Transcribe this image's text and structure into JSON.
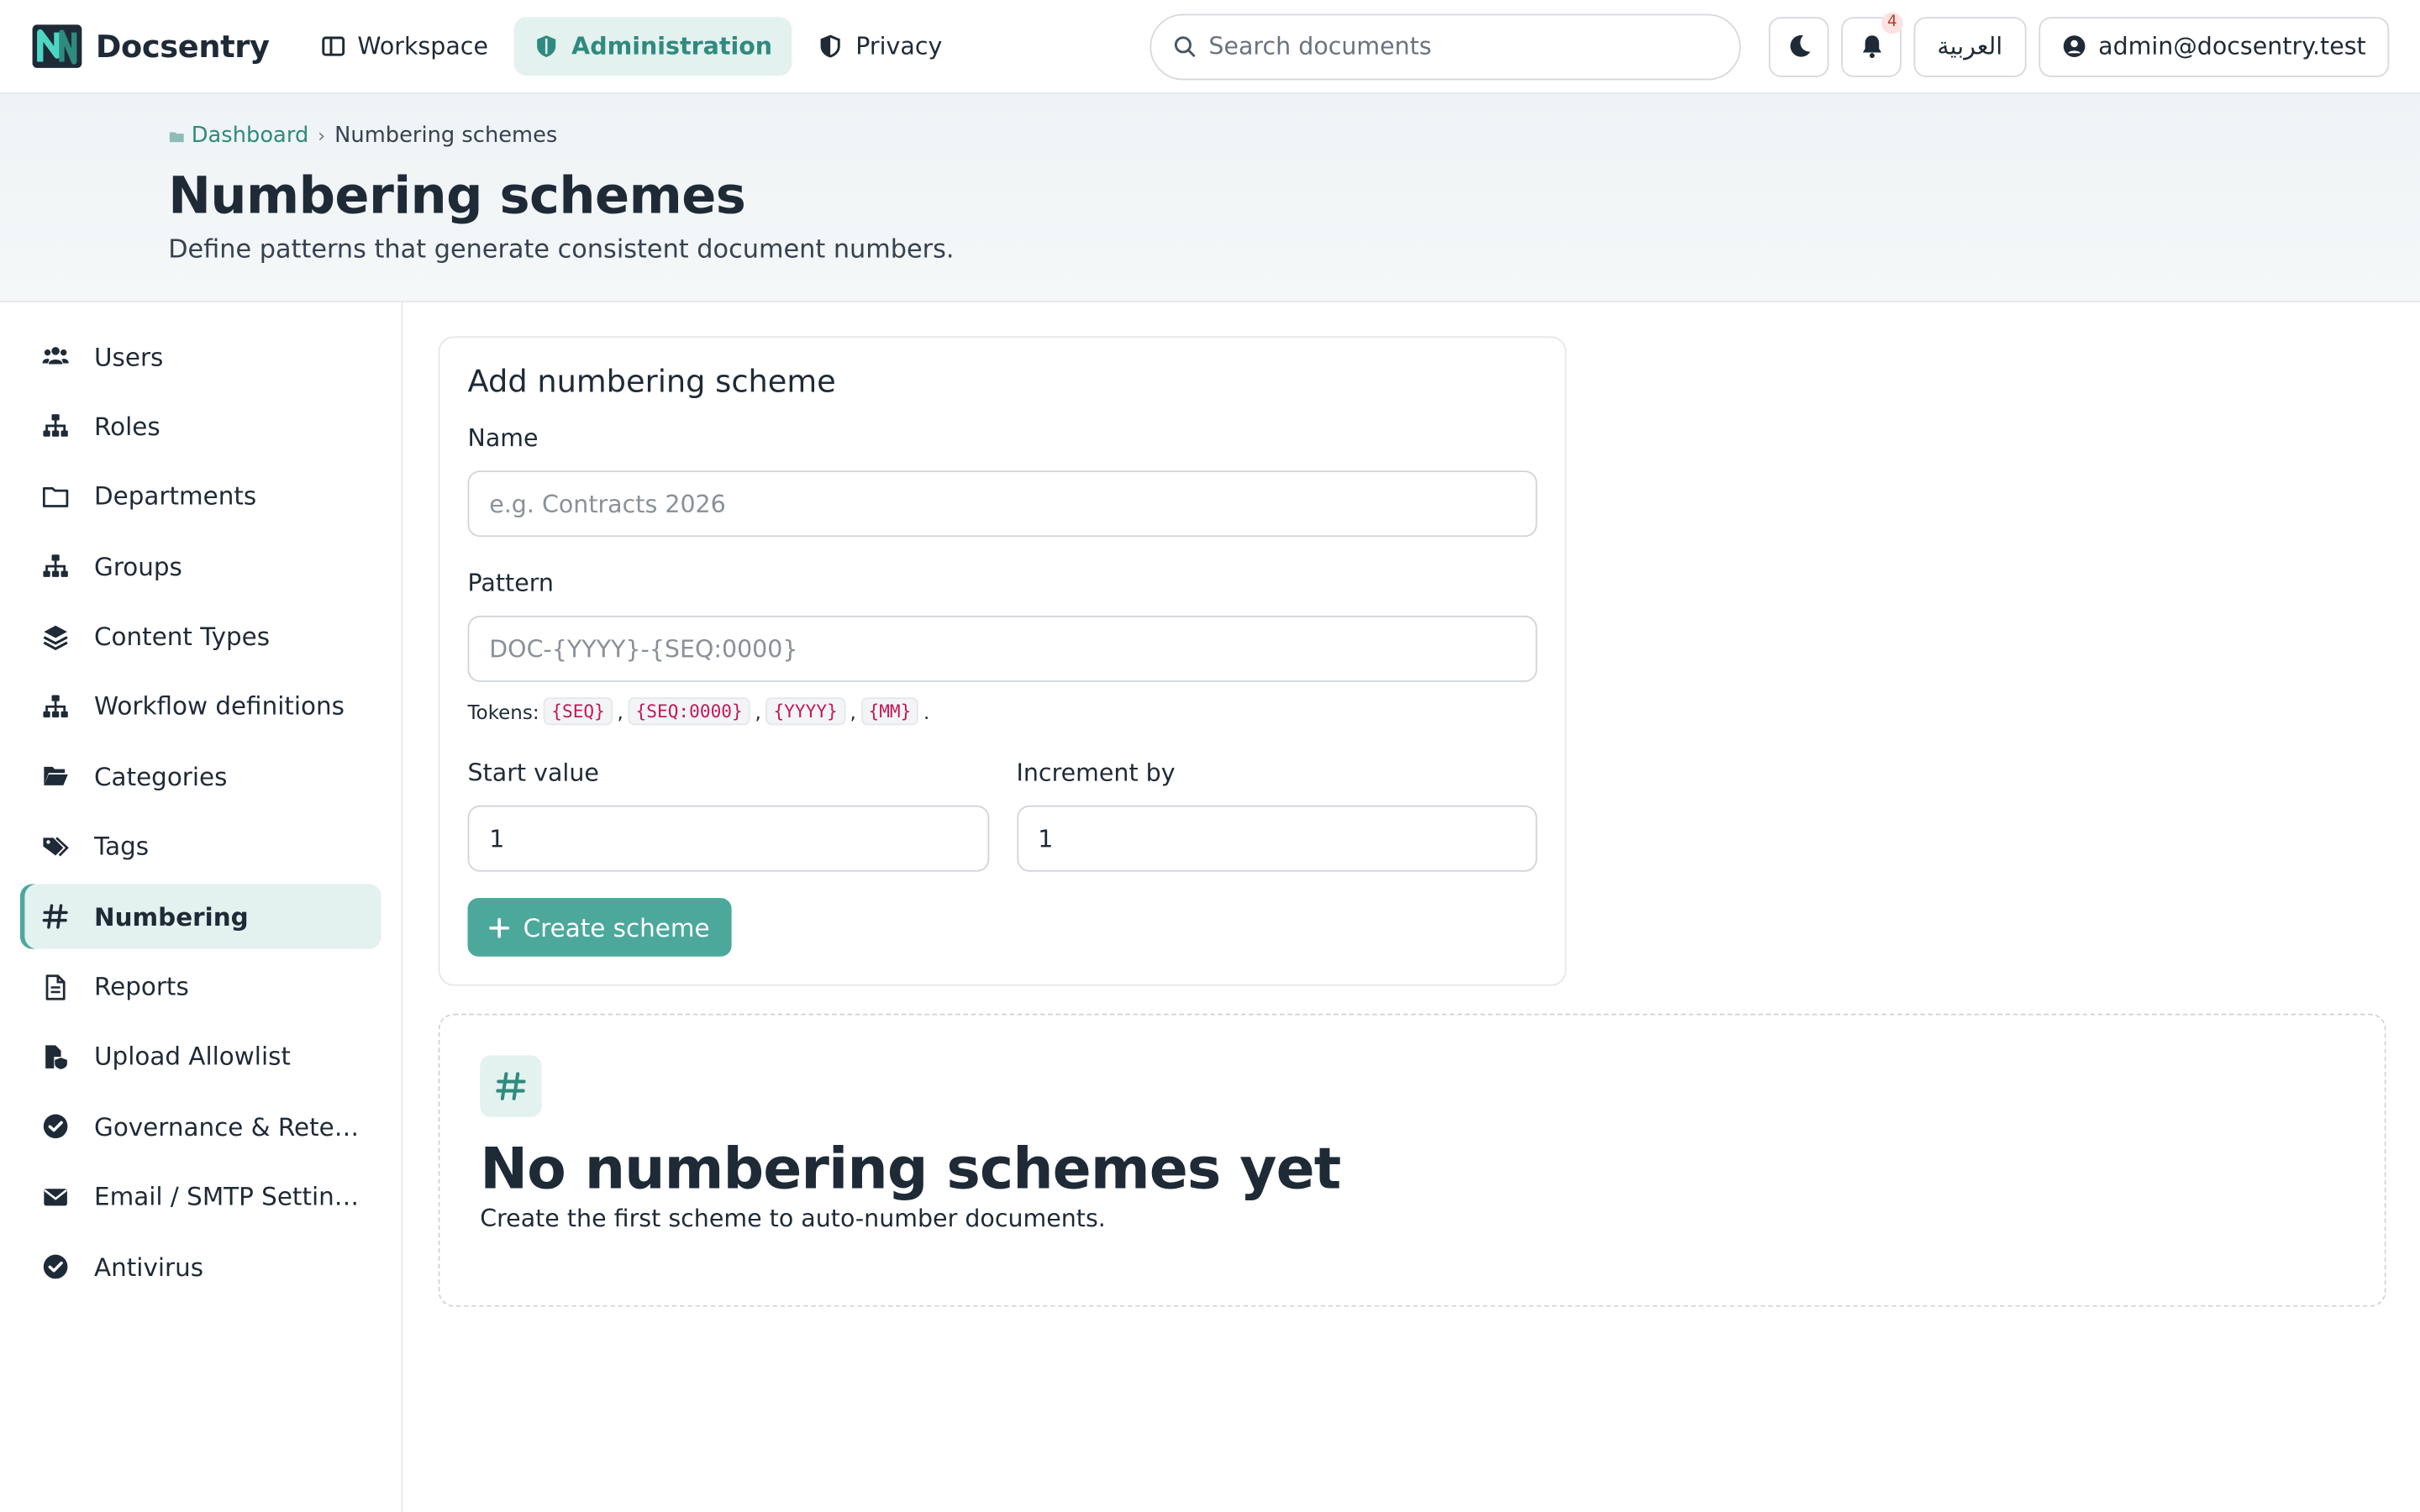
{
  "app": {
    "name": "Docsentry"
  },
  "nav": {
    "items": [
      {
        "label": "Workspace",
        "icon": "columns-icon"
      },
      {
        "label": "Administration",
        "icon": "shield-icon",
        "active": true
      },
      {
        "label": "Privacy",
        "icon": "shield-half-icon"
      }
    ]
  },
  "search": {
    "placeholder": "Search documents",
    "value": ""
  },
  "header_actions": {
    "theme_icon": "moon-icon",
    "notifications_count": "4",
    "language_label": "العربية",
    "user_email": "admin@docsentry.test"
  },
  "breadcrumb": {
    "home": "Dashboard",
    "current": "Numbering schemes"
  },
  "page": {
    "title": "Numbering schemes",
    "subtitle": "Define patterns that generate consistent document numbers."
  },
  "sidebar": {
    "items": [
      {
        "label": "Users",
        "icon": "users-icon"
      },
      {
        "label": "Roles",
        "icon": "hierarchy-icon"
      },
      {
        "label": "Departments",
        "icon": "folder-outline-icon"
      },
      {
        "label": "Groups",
        "icon": "hierarchy-icon"
      },
      {
        "label": "Content Types",
        "icon": "layers-icon"
      },
      {
        "label": "Workflow definitions",
        "icon": "hierarchy-icon"
      },
      {
        "label": "Categories",
        "icon": "folder-open-icon"
      },
      {
        "label": "Tags",
        "icon": "tags-icon"
      },
      {
        "label": "Numbering",
        "icon": "hash-icon",
        "active": true
      },
      {
        "label": "Reports",
        "icon": "file-icon"
      },
      {
        "label": "Upload Allowlist",
        "icon": "file-shield-icon"
      },
      {
        "label": "Governance & Retention",
        "icon": "check-circle-icon"
      },
      {
        "label": "Email / SMTP Settings",
        "icon": "envelope-icon"
      },
      {
        "label": "Antivirus",
        "icon": "check-circle-icon"
      }
    ]
  },
  "form": {
    "title": "Add numbering scheme",
    "name_label": "Name",
    "name_placeholder": "e.g. Contracts 2026",
    "name_value": "",
    "pattern_label": "Pattern",
    "pattern_placeholder": "DOC-{YYYY}-{SEQ:0000}",
    "pattern_value": "",
    "tokens_label": "Tokens:",
    "tokens": [
      "{SEQ}",
      "{SEQ:0000}",
      "{YYYY}",
      "{MM}"
    ],
    "start_label": "Start value",
    "start_value": "1",
    "increment_label": "Increment by",
    "increment_value": "1",
    "submit_label": "Create scheme"
  },
  "empty_state": {
    "title": "No numbering schemes yet",
    "subtitle": "Create the first scheme to auto-number documents."
  },
  "colors": {
    "accent": "#4da89c",
    "accent_dark": "#2f8a7f",
    "accent_bg": "#e3f1ef"
  }
}
